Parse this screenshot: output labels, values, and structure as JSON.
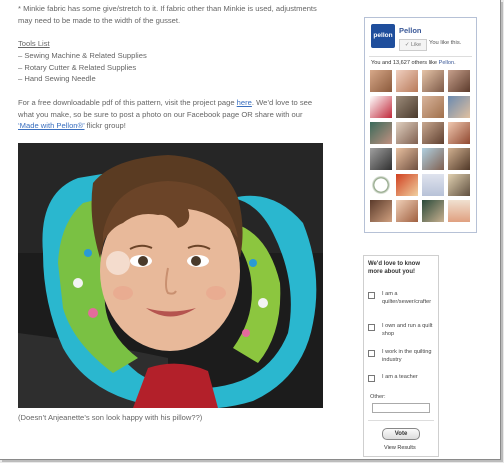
{
  "article": {
    "intro": "* Minkie fabric has some give/stretch to it. If fabric other than Minkie is used, adjustments may need to be made to the width of the gusset.",
    "tools_title": "Tools List",
    "tools": [
      "– Sewing Machine & Related Supplies",
      "– Rotary Cutter & Related Supplies",
      "– Hand Sewing Needle"
    ],
    "pdf_before": "For a free downloadable pdf of this pattern, visit the project page ",
    "pdf_link": "here",
    "pdf_mid": ". We’d love to see what you make, so be sure to post a photo on our Facebook page OR share with our ",
    "pdf_link2": "‘Made with Pellon®’",
    "pdf_after": " flickr group!",
    "caption": "(Doesn’t Anjeanette’s son look happy with his pillow??)"
  },
  "facebook": {
    "logo_text": "pellon",
    "page_name": "Pellon",
    "like_button": "Like",
    "likes_this": "You like this.",
    "count_prefix": "You and 13,627 others like ",
    "count_page": "Pellon",
    "count_suffix": "."
  },
  "poll": {
    "question": "We'd love to know more about you!",
    "options": [
      "I am a quilter/sewer/crafter",
      "I own and run a quilt shop",
      "I work in the quilting industry",
      "I am a teacher"
    ],
    "other_label": "Other:",
    "vote_button": "Vote",
    "view_results": "View Results"
  }
}
